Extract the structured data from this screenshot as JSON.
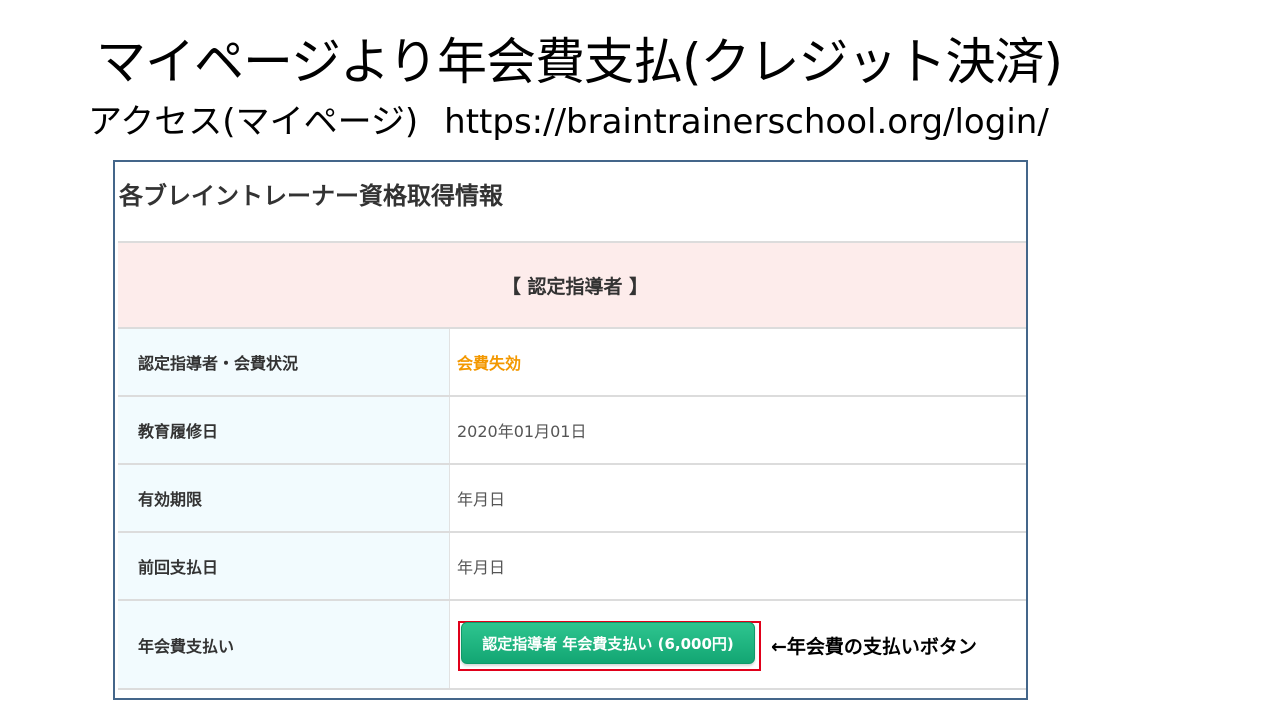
{
  "slide": {
    "title": "マイページより年会費支払(クレジット決済)",
    "subtitle_prefix": "アクセス(マイページ)",
    "subtitle_url": "https://braintrainerschool.org/login/"
  },
  "panel": {
    "heading": "各ブレイントレーナー資格取得情報",
    "certification_header": "【 認定指導者 】",
    "rows": [
      {
        "label": "認定指導者・会費状況",
        "value": "会費失効"
      },
      {
        "label": "教育履修日",
        "value": "2020年01月01日"
      },
      {
        "label": "有効期限",
        "value": "年月日"
      },
      {
        "label": "前回支払日",
        "value": "年月日"
      },
      {
        "label": "年会費支払い",
        "value": ""
      }
    ],
    "pay_button_label": "認定指導者 年会費支払い (6,000円)"
  },
  "annotation": "←年会費の支払いボタン",
  "colors": {
    "panel_border": "#44668a",
    "header_bg": "#fdeceb",
    "label_bg": "#f2fbfe",
    "status_lapsed": "#f39800",
    "button_green": "#13a673",
    "highlight_frame": "#e0001a"
  }
}
